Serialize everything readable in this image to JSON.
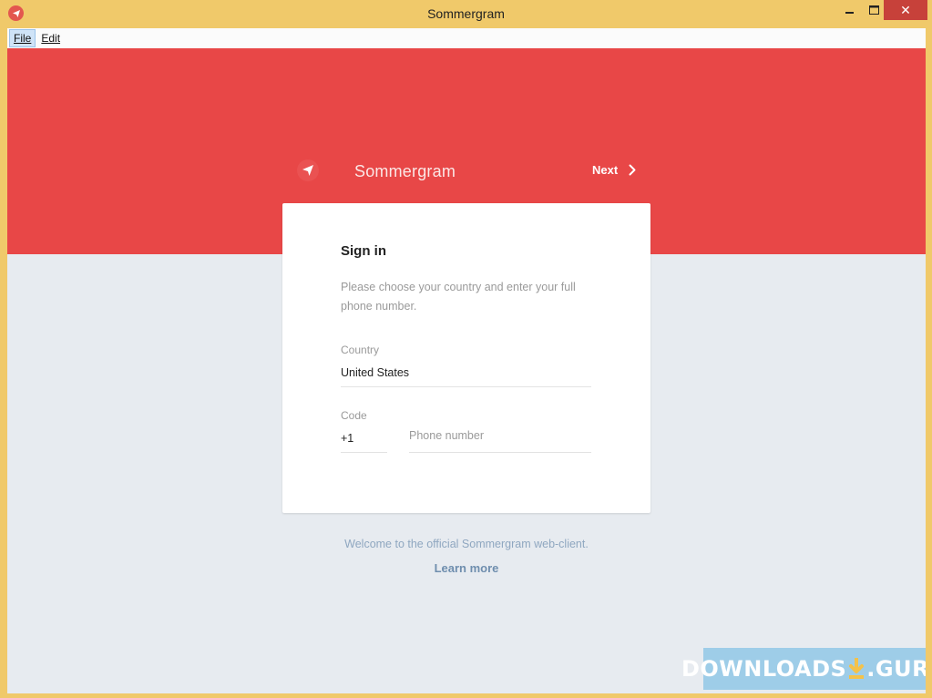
{
  "window": {
    "title": "Sommergram",
    "close_glyph": "✕"
  },
  "menu": {
    "items": [
      {
        "label": "File"
      },
      {
        "label": "Edit"
      }
    ]
  },
  "header": {
    "brand": "Sommergram",
    "next_label": "Next"
  },
  "signin": {
    "title": "Sign in",
    "description": "Please choose your country and enter your full phone number.",
    "country_label": "Country",
    "country_value": "United States",
    "code_label": "Code",
    "code_value": "+1",
    "phone_placeholder": "Phone number",
    "phone_value": ""
  },
  "footer": {
    "welcome": "Welcome to the official Sommergram web-client.",
    "learn_more": "Learn more"
  },
  "watermark": {
    "left": "DOWNLOADS",
    "right": ".GURU"
  },
  "colors": {
    "accent": "#e84747",
    "frame": "#f0c96a",
    "background": "#e7ebf0",
    "link": "#6f8eae"
  }
}
